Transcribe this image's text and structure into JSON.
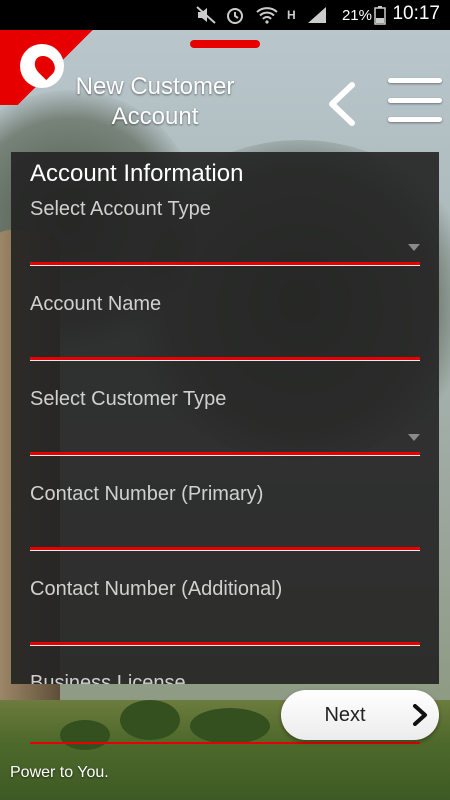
{
  "status_bar": {
    "battery_percent": "21%",
    "time": "10:17",
    "icons": [
      "mute-icon",
      "alarm-icon",
      "wifi-icon",
      "h-network-icon",
      "signal-icon",
      "battery-charging-icon"
    ]
  },
  "header": {
    "title_line1": "New Customer",
    "title_line2": "Account",
    "logo": "vodafone-logo-icon",
    "back_icon": "chevron-left-icon",
    "menu_icon": "hamburger-menu-icon"
  },
  "form": {
    "section_title": "Account Information",
    "fields": [
      {
        "label": "Select Account Type",
        "type": "dropdown",
        "value": ""
      },
      {
        "label": "Account Name",
        "type": "text",
        "value": ""
      },
      {
        "label": "Select Customer Type",
        "type": "dropdown",
        "value": ""
      },
      {
        "label": "Contact Number (Primary)",
        "type": "text",
        "value": ""
      },
      {
        "label": "Contact Number (Additional)",
        "type": "text",
        "value": ""
      },
      {
        "label": "Business License",
        "type": "text",
        "value": ""
      }
    ]
  },
  "next_button": {
    "label": "Next",
    "icon": "chevron-right-icon"
  },
  "footer": {
    "tagline": "Power to You."
  },
  "colors": {
    "brand_red": "#e60000",
    "card_bg": "#222222"
  }
}
